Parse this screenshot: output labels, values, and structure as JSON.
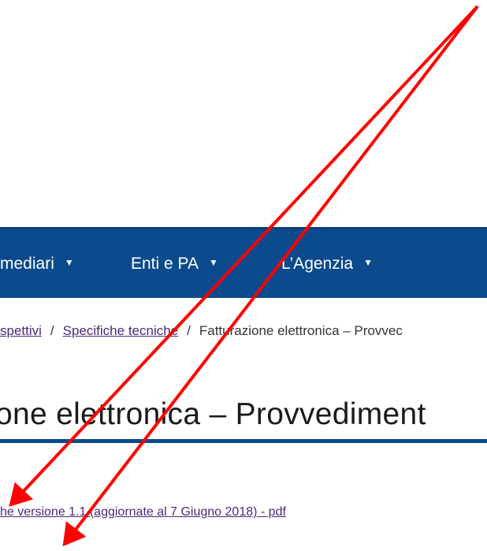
{
  "nav": {
    "items": [
      {
        "label": "mediari"
      },
      {
        "label": "Enti e PA"
      },
      {
        "label": "L’Agenzia"
      }
    ]
  },
  "breadcrumb": {
    "prev_link": "spettivi",
    "specifiche_link": "Specifiche tecniche",
    "current": "Fatturazione elettronica – Provvec",
    "separator": "/"
  },
  "page": {
    "title": "one elettronica – Provvediment",
    "pdf_link": "he versione 1.1 (aggiornate al 7 Giugno 2018) - pdf"
  },
  "annotation": {
    "arrow_color": "#ff0000"
  }
}
